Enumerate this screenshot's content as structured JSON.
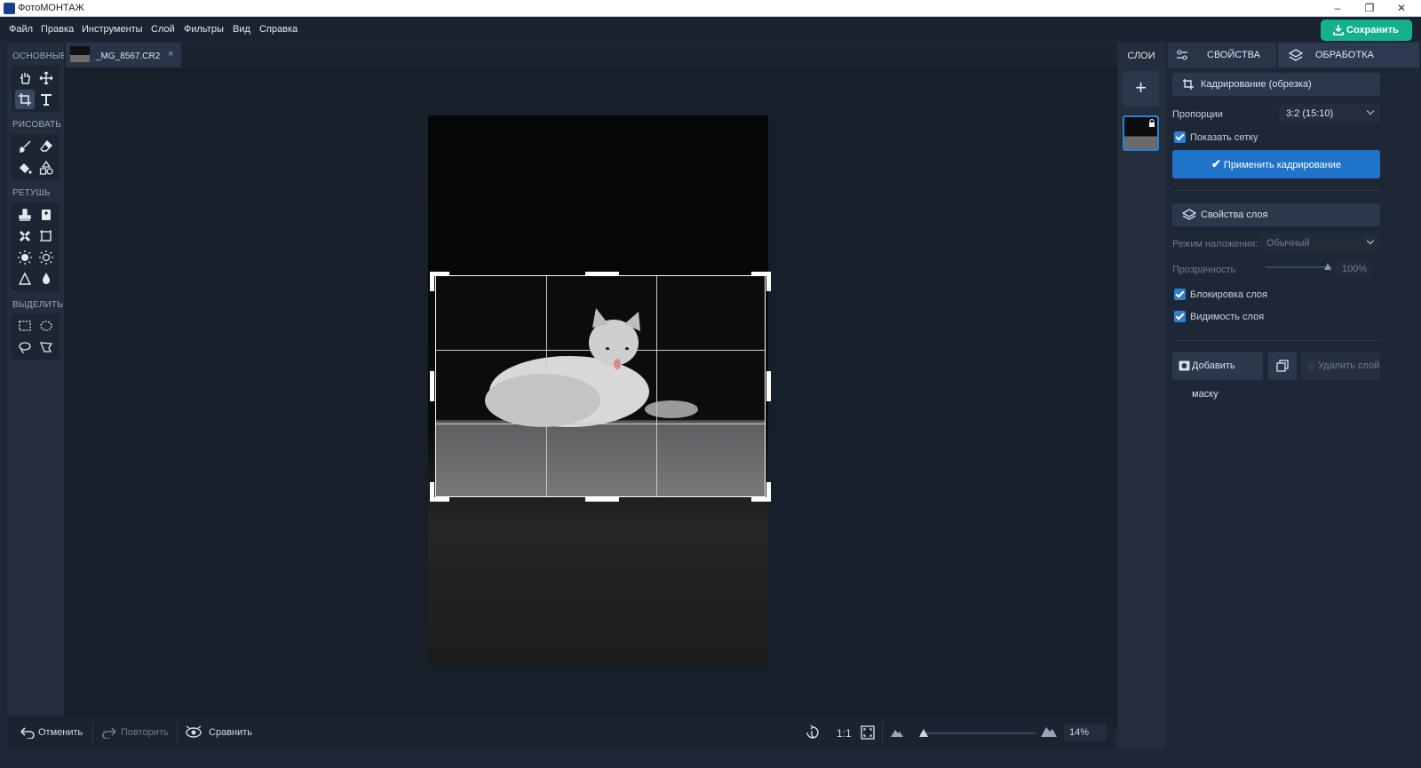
{
  "window": {
    "title": "ФотоМОНТАЖ",
    "minimize": "–",
    "restore": "❐",
    "close": "✕"
  },
  "menu": [
    "Файл",
    "Правка",
    "Инструменты",
    "Слой",
    "Фильтры",
    "Вид",
    "Справка"
  ],
  "save_button": "Сохранить",
  "tools": {
    "groups": [
      "ОСНОВНЫЕ",
      "РИСОВАТЬ",
      "РЕТУШЬ",
      "ВЫДЕЛИТЬ"
    ],
    "active": "crop-tool"
  },
  "document": {
    "tab_name": "_MG_8567.CR2",
    "close": "×"
  },
  "crop": {
    "aspect_w": 3,
    "aspect_h": 2,
    "grid": true
  },
  "bottom": {
    "undo": "Отменить",
    "redo": "Повторить",
    "compare": "Сравнить",
    "one_to_one": "1:1",
    "zoom": "14%",
    "zoom_fraction": 0.03
  },
  "layers": {
    "header": "СЛОИ",
    "add": "+"
  },
  "properties": {
    "tab_properties": "СВОЙСТВА",
    "tab_processing": "ОБРАБОТКА",
    "crop_section": "Кадрирование (обрезка)",
    "proportions_label": "Пропорции",
    "proportions_value": "3:2 (15:10)",
    "show_grid": "Показать сетку",
    "apply_crop": "Применить кадрирование",
    "layer_props_section": "Свойства слоя",
    "blend_label": "Режим наложения:",
    "blend_value": "Обычный",
    "opacity_label": "Прозрачность",
    "opacity_value": "100%",
    "lock_layer": "Блокировка слоя",
    "layer_visibility": "Видимость слоя",
    "add_mask": "Добавить маску",
    "delete_layer": "Удалить слой"
  },
  "colors": {
    "accent": "#1f74c9",
    "save": "#14b18e",
    "panel": "#232d3c"
  }
}
